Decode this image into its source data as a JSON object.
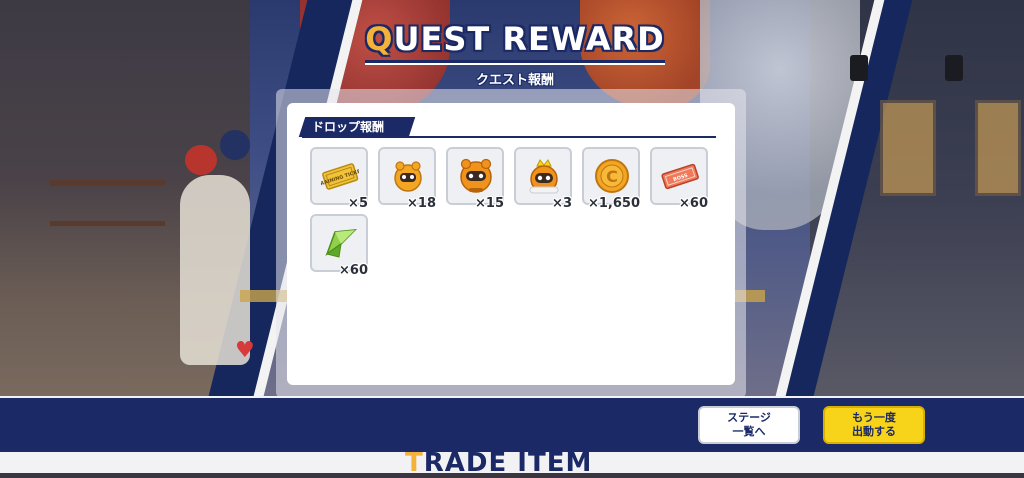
{
  "title": {
    "first_letter": "Q",
    "rest": "UEST REWARD",
    "subtitle": "クエスト報酬"
  },
  "drop_section": {
    "label": "ドロップ報酬"
  },
  "items": [
    {
      "icon": "training-ticket-icon",
      "quantity": "×5",
      "ticket_text": "TRAINING TICKET"
    },
    {
      "icon": "small-mascot-icon",
      "quantity": "×18"
    },
    {
      "icon": "medium-mascot-icon",
      "quantity": "×15"
    },
    {
      "icon": "crowned-mascot-icon",
      "quantity": "×3"
    },
    {
      "icon": "gold-coin-icon",
      "quantity": "×1,650",
      "coin_text": "C"
    },
    {
      "icon": "boss-ticket-icon",
      "quantity": "×60",
      "ticket_text": "BOSS"
    },
    {
      "icon": "green-crystal-icon",
      "quantity": "×60"
    }
  ],
  "buttons": {
    "stage_list": "ステージ\n一覧へ",
    "sortie_again": "もう一度\n出動する"
  },
  "bottom": {
    "first_letter": "T",
    "rest": "RADE ITEM"
  },
  "colors": {
    "navy": "#1b2a66",
    "gold": "#f4b23a",
    "yellow_button": "#f7d31a",
    "panel": "#ffffff"
  }
}
